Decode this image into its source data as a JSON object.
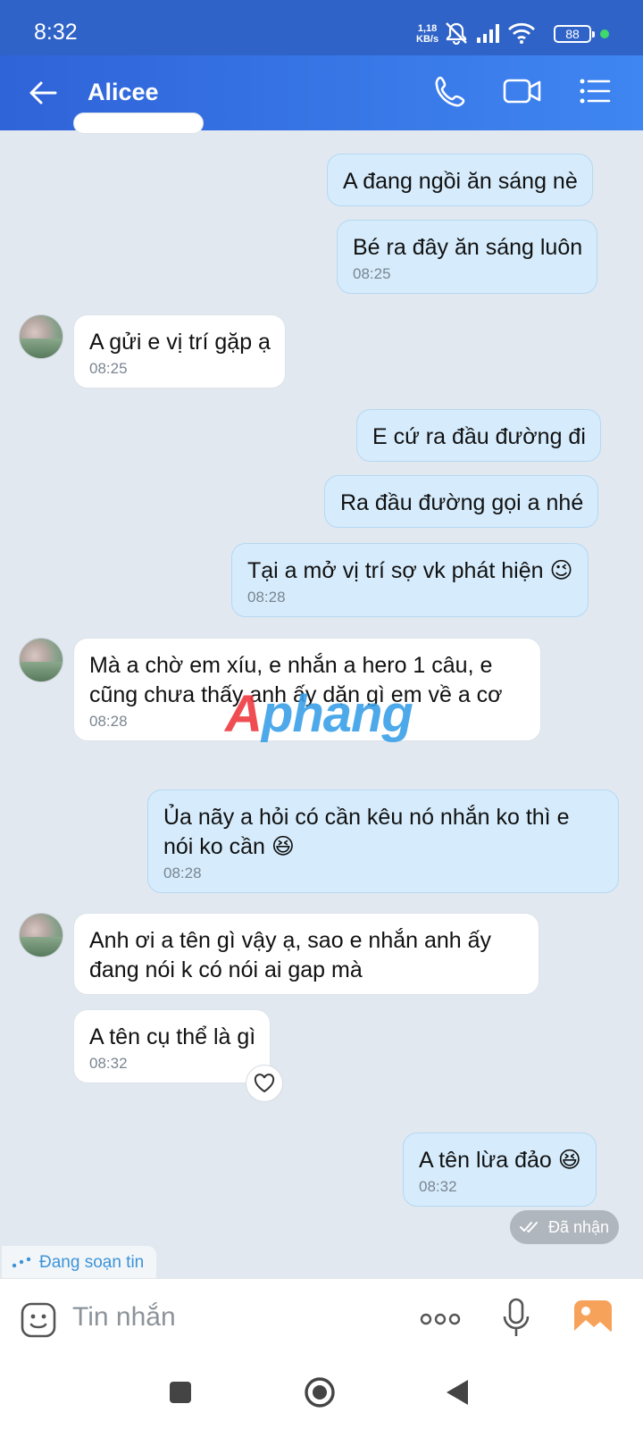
{
  "status_bar": {
    "time": "8:32",
    "speed_value": "1,18",
    "speed_unit": "KB/s",
    "battery": "88",
    "icons": [
      "mute-icon",
      "signal-icon",
      "wifi-icon",
      "battery-icon"
    ]
  },
  "header": {
    "contact_name": "Alicee",
    "icons": [
      "back-arrow-icon",
      "phone-call-icon",
      "video-call-icon",
      "menu-list-icon"
    ]
  },
  "messages": [
    {
      "direction": "out",
      "text": "A đang ngồi ăn sáng nè",
      "time": ""
    },
    {
      "direction": "out",
      "text": "Bé ra đây ăn sáng luôn",
      "time": "08:25"
    },
    {
      "direction": "in",
      "text": "A gửi e vị trí gặp ạ",
      "time": "08:25"
    },
    {
      "direction": "out",
      "text": "E cứ ra đầu đường đi",
      "time": ""
    },
    {
      "direction": "out",
      "text": "Ra đầu đường gọi a nhé",
      "time": ""
    },
    {
      "direction": "out",
      "text": "Tại a mở vị trí sợ vk phát hiện 😉",
      "time": "08:28"
    },
    {
      "direction": "in",
      "text": "Mà a chờ em xíu, e nhắn a hero 1 câu, e cũng chưa thấy anh ấy dặn gì em về a cơ",
      "time": "08:28"
    },
    {
      "direction": "out",
      "text": "Ủa nãy a hỏi có cần kêu nó nhắn ko thì e nói ko cần 😆",
      "time": "08:28"
    },
    {
      "direction": "in",
      "text": "Anh ơi a tên gì vậy ạ, sao e nhắn anh ấy đang nói k có nói ai gap mà",
      "time": ""
    },
    {
      "direction": "in",
      "text": "A tên cụ thể là gì",
      "time": "08:32"
    },
    {
      "direction": "out",
      "text": "A tên lừa đảo 😆",
      "time": "08:32"
    }
  ],
  "read_receipt": "Đã nhận",
  "typing_indicator": "Đang soạn tin",
  "watermark": {
    "part1": "A",
    "part2": "phang"
  },
  "input": {
    "placeholder": "Tin nhắn",
    "icons": [
      "sticker-icon",
      "more-dots-icon",
      "microphone-icon",
      "image-gallery-icon"
    ]
  },
  "nav": {
    "icons": [
      "recent-apps-icon",
      "home-icon",
      "back-icon"
    ]
  },
  "colors": {
    "header": "#3f86f2",
    "outgoing_bubble": "#d6ecfc",
    "incoming_bubble": "#ffffff",
    "background": "#e2e8f0"
  }
}
